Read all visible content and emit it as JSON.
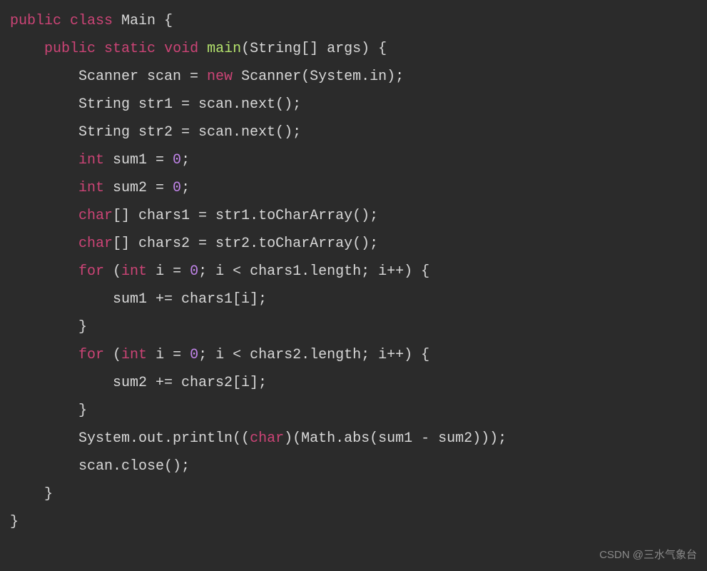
{
  "code": {
    "tokens": [
      [
        {
          "t": "public",
          "c": "kw"
        },
        {
          "t": " ",
          "c": "plain"
        },
        {
          "t": "class",
          "c": "kw"
        },
        {
          "t": " Main {",
          "c": "plain"
        }
      ],
      [
        {
          "t": "    ",
          "c": "plain"
        },
        {
          "t": "public",
          "c": "kw"
        },
        {
          "t": " ",
          "c": "plain"
        },
        {
          "t": "static",
          "c": "kw"
        },
        {
          "t": " ",
          "c": "plain"
        },
        {
          "t": "void",
          "c": "kw"
        },
        {
          "t": " ",
          "c": "plain"
        },
        {
          "t": "main",
          "c": "fn"
        },
        {
          "t": "(String[] args) {",
          "c": "plain"
        }
      ],
      [
        {
          "t": "        Scanner scan = ",
          "c": "plain"
        },
        {
          "t": "new",
          "c": "kw"
        },
        {
          "t": " Scanner(System.in);",
          "c": "plain"
        }
      ],
      [
        {
          "t": "        String str1 = scan.next();",
          "c": "plain"
        }
      ],
      [
        {
          "t": "        String str2 = scan.next();",
          "c": "plain"
        }
      ],
      [
        {
          "t": "        ",
          "c": "plain"
        },
        {
          "t": "int",
          "c": "kw"
        },
        {
          "t": " sum1 = ",
          "c": "plain"
        },
        {
          "t": "0",
          "c": "num"
        },
        {
          "t": ";",
          "c": "plain"
        }
      ],
      [
        {
          "t": "        ",
          "c": "plain"
        },
        {
          "t": "int",
          "c": "kw"
        },
        {
          "t": " sum2 = ",
          "c": "plain"
        },
        {
          "t": "0",
          "c": "num"
        },
        {
          "t": ";",
          "c": "plain"
        }
      ],
      [
        {
          "t": "        ",
          "c": "plain"
        },
        {
          "t": "char",
          "c": "kw"
        },
        {
          "t": "[] chars1 = str1.toCharArray();",
          "c": "plain"
        }
      ],
      [
        {
          "t": "        ",
          "c": "plain"
        },
        {
          "t": "char",
          "c": "kw"
        },
        {
          "t": "[] chars2 = str2.toCharArray();",
          "c": "plain"
        }
      ],
      [
        {
          "t": "        ",
          "c": "plain"
        },
        {
          "t": "for",
          "c": "kw"
        },
        {
          "t": " (",
          "c": "plain"
        },
        {
          "t": "int",
          "c": "kw"
        },
        {
          "t": " i = ",
          "c": "plain"
        },
        {
          "t": "0",
          "c": "num"
        },
        {
          "t": "; i < chars1.length; i++) {",
          "c": "plain"
        }
      ],
      [
        {
          "t": "            sum1 += chars1[i];",
          "c": "plain"
        }
      ],
      [
        {
          "t": "        }",
          "c": "plain"
        }
      ],
      [
        {
          "t": "        ",
          "c": "plain"
        },
        {
          "t": "for",
          "c": "kw"
        },
        {
          "t": " (",
          "c": "plain"
        },
        {
          "t": "int",
          "c": "kw"
        },
        {
          "t": " i = ",
          "c": "plain"
        },
        {
          "t": "0",
          "c": "num"
        },
        {
          "t": "; i < chars2.length; i++) {",
          "c": "plain"
        }
      ],
      [
        {
          "t": "            sum2 += chars2[i];",
          "c": "plain"
        }
      ],
      [
        {
          "t": "        }",
          "c": "plain"
        }
      ],
      [
        {
          "t": "        System.out.println((",
          "c": "plain"
        },
        {
          "t": "char",
          "c": "kw"
        },
        {
          "t": ")(Math.abs(sum1 - sum2)));",
          "c": "plain"
        }
      ],
      [
        {
          "t": "        scan.close();",
          "c": "plain"
        }
      ],
      [
        {
          "t": "    }",
          "c": "plain"
        }
      ],
      [
        {
          "t": "}",
          "c": "plain"
        }
      ]
    ]
  },
  "watermark": "CSDN @三水气象台"
}
